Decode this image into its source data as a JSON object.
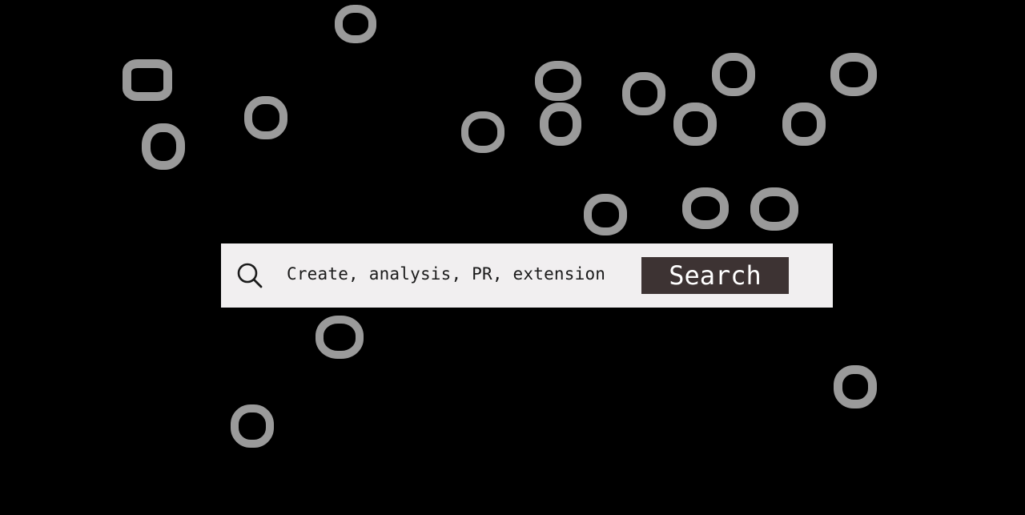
{
  "search": {
    "query": "Create, analysis, PR, extension",
    "button_label": "Search"
  },
  "colors": {
    "background": "#000000",
    "bar": "#f1eff0",
    "button": "#3d3333",
    "rings": "#9a9a9a"
  },
  "icons": {
    "search": "search-icon"
  }
}
